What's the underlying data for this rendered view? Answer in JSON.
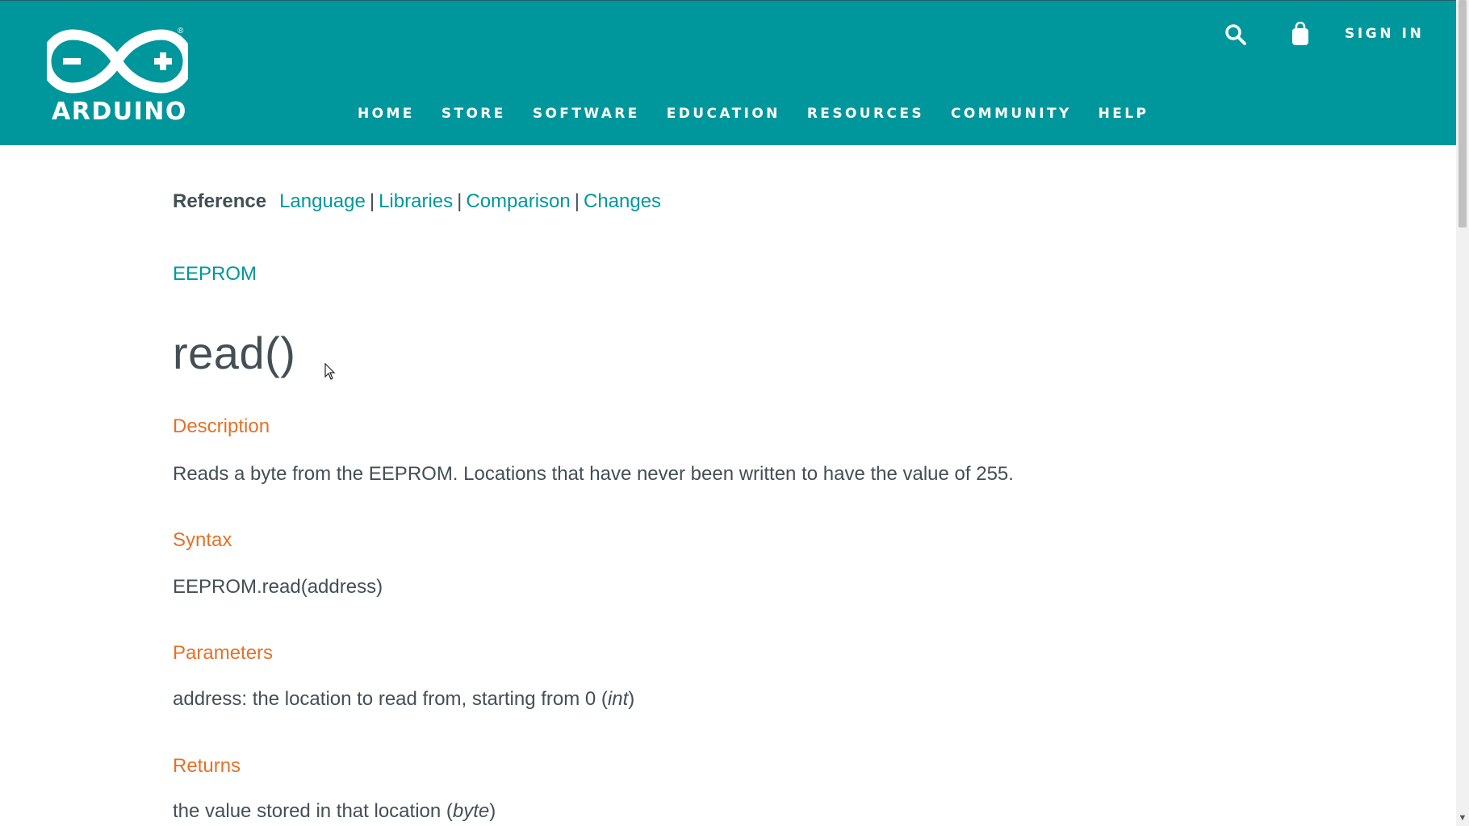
{
  "header": {
    "brand": "ARDUINO",
    "registered_mark": "®",
    "nav": [
      "HOME",
      "STORE",
      "SOFTWARE",
      "EDUCATION",
      "RESOURCES",
      "COMMUNITY",
      "HELP"
    ],
    "sign_in": "SIGN IN",
    "icons": [
      "search-icon",
      "shopping-bag-icon"
    ],
    "background_color": "#00979c"
  },
  "breadcrumb": {
    "label": "Reference",
    "links": [
      "Language",
      "Libraries",
      "Comparison",
      "Changes"
    ],
    "separator": "|"
  },
  "parent_link": "EEPROM",
  "title": "read()",
  "sections": {
    "description": {
      "heading": "Description",
      "text": "Reads a byte from the EEPROM. Locations that have never been written to have the value of 255."
    },
    "syntax": {
      "heading": "Syntax",
      "text": "EEPROM.read(address)"
    },
    "parameters": {
      "heading": "Parameters",
      "text": "address: the location to read from, starting from 0 (",
      "type": "int",
      "close": ")"
    },
    "returns": {
      "heading": "Returns",
      "text": "the value stored in that location (",
      "type": "byte",
      "close": ")"
    }
  },
  "colors": {
    "link": "#00979c",
    "section_heading": "#e47128",
    "body_text": "#434f54"
  }
}
